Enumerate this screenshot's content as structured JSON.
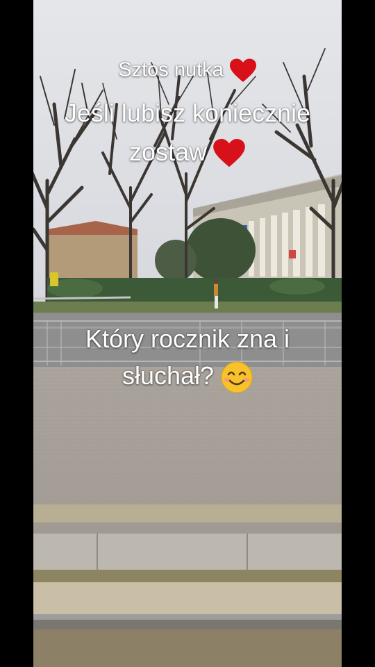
{
  "overlay": {
    "line1": "Sztos nutka",
    "line2": "Jeśli lubisz koniecznie",
    "line3": "zostaw",
    "line4": "Który rocznik zna i",
    "line5": "słuchał?",
    "heart_icon": "red-heart-icon",
    "emoji_icon": "smiling-face-icon"
  },
  "colors": {
    "heart": "#d8101a",
    "text": "#ffffff",
    "sky": "#dfe1e6",
    "pavement": "#a9a39c",
    "letterbox": "#000000"
  }
}
